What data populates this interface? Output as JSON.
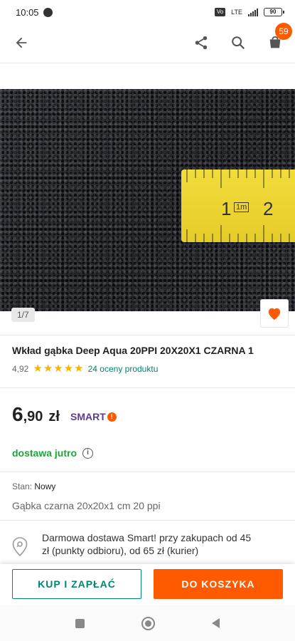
{
  "status_bar": {
    "time": "10:05",
    "network": "LTE",
    "vo_label": "Vo",
    "battery": "90"
  },
  "app_bar": {
    "cart_count": "59"
  },
  "gallery": {
    "page_indicator": "1/7",
    "ruler_mark_1": "1",
    "ruler_unit": "1m",
    "ruler_mark_2": "2"
  },
  "product": {
    "title": "Wkład gąbka Deep Aqua 20PPI 20X20X1 CZARNA 1",
    "rating_value": "4,92",
    "stars": 5,
    "rating_link": "24 oceny produktu",
    "price_main": "6",
    "price_decimal": ",90",
    "price_currency": "zł",
    "smart_label": "SMART",
    "smart_mark": "!",
    "delivery": "dostawa jutro",
    "info_icon": "i",
    "condition_label": "Stan:",
    "condition_value": "Nowy",
    "short_description": "Gąbka czarna 20x20x1 cm 20 ppi",
    "shipping_info": "Darmowa dostawa Smart! przy zakupach od 45 zł (punkty odbioru), od 65 zł (kurier)"
  },
  "actions": {
    "buy_now": "KUP I ZAPŁAĆ",
    "add_to_cart": "DO KOSZYKA"
  },
  "colors": {
    "accent": "#ff5a00",
    "teal": "#00856f",
    "green": "#1ea537",
    "smart_purple": "#5a3c91",
    "star": "#f7b500"
  }
}
